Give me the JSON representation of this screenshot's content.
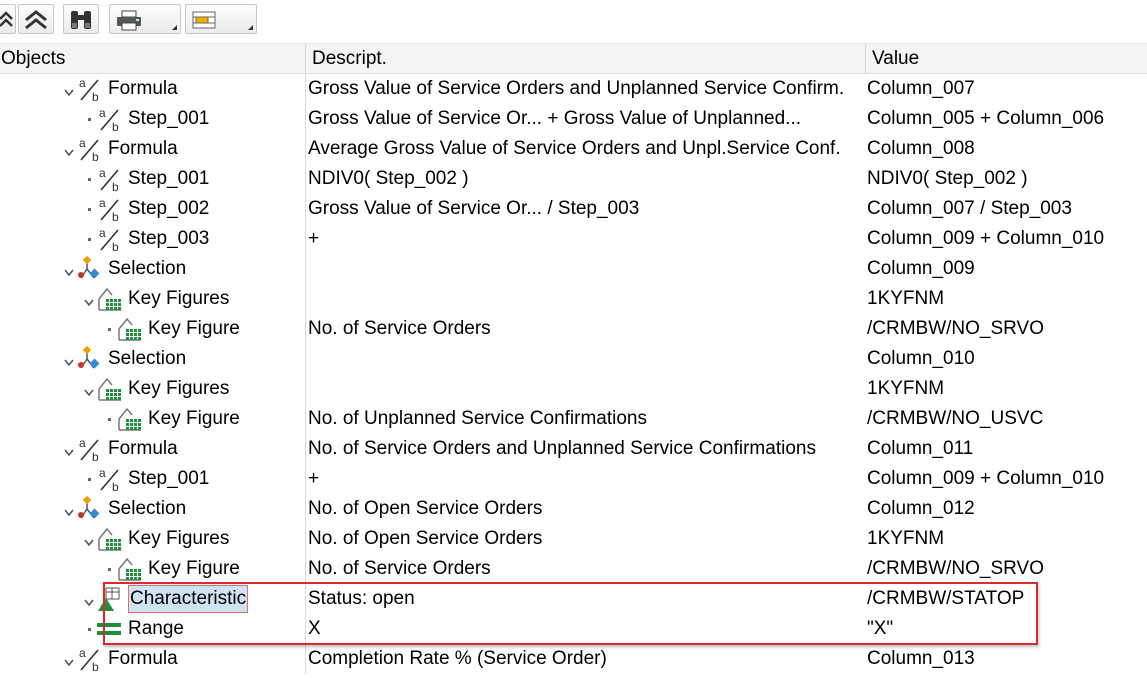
{
  "columns": {
    "objects": "Objects",
    "descript": "Descript.",
    "value": "Value"
  },
  "rows": [
    {
      "indent": 0,
      "expander": "chevron",
      "icon": "formula-icon",
      "label": "Formula",
      "desc": "Gross Value of Service Orders and Unplanned Service Confirm.",
      "value": "Column_007"
    },
    {
      "indent": 1,
      "expander": "dot",
      "icon": "formula-icon",
      "label": "Step_001",
      "desc": "Gross Value of Service Or... + Gross Value of Unplanned...",
      "value": "Column_005 + Column_006"
    },
    {
      "indent": 0,
      "expander": "chevron",
      "icon": "formula-icon",
      "label": "Formula",
      "desc": "Average Gross Value of Service Orders and Unpl.Service Conf.",
      "value": "Column_008"
    },
    {
      "indent": 1,
      "expander": "dot",
      "icon": "formula-icon",
      "label": "Step_001",
      "desc": "NDIV0( Step_002 )",
      "value": "NDIV0( Step_002 )"
    },
    {
      "indent": 1,
      "expander": "dot",
      "icon": "formula-icon",
      "label": "Step_002",
      "desc": "Gross Value of Service Or... / Step_003",
      "value": "Column_007 / Step_003"
    },
    {
      "indent": 1,
      "expander": "dot",
      "icon": "formula-icon",
      "label": "Step_003",
      "desc": "+",
      "value": "Column_009 + Column_010"
    },
    {
      "indent": 0,
      "expander": "chevron",
      "icon": "selection-icon",
      "label": "Selection",
      "desc": "",
      "value": "Column_009"
    },
    {
      "indent": 1,
      "expander": "chevron",
      "icon": "key-figures-icon",
      "label": "Key Figures",
      "desc": "",
      "value": "1KYFNM"
    },
    {
      "indent": 2,
      "expander": "dot",
      "icon": "key-figures-icon",
      "label": "Key Figure",
      "desc": "No. of Service Orders",
      "value": "/CRMBW/NO_SRVO"
    },
    {
      "indent": 0,
      "expander": "chevron",
      "icon": "selection-icon",
      "label": "Selection",
      "desc": "",
      "value": "Column_010"
    },
    {
      "indent": 1,
      "expander": "chevron",
      "icon": "key-figures-icon",
      "label": "Key Figures",
      "desc": "",
      "value": "1KYFNM"
    },
    {
      "indent": 2,
      "expander": "dot",
      "icon": "key-figures-icon",
      "label": "Key Figure",
      "desc": "No. of Unplanned Service Confirmations",
      "value": "/CRMBW/NO_USVC"
    },
    {
      "indent": 0,
      "expander": "chevron",
      "icon": "formula-icon",
      "label": "Formula",
      "desc": "No. of Service Orders and Unplanned Service Confirmations",
      "value": "Column_011"
    },
    {
      "indent": 1,
      "expander": "dot",
      "icon": "formula-icon",
      "label": "Step_001",
      "desc": "+",
      "value": "Column_009 + Column_010"
    },
    {
      "indent": 0,
      "expander": "chevron",
      "icon": "selection-icon",
      "label": "Selection",
      "desc": "No. of Open Service Orders",
      "value": "Column_012"
    },
    {
      "indent": 1,
      "expander": "chevron",
      "icon": "key-figures-icon",
      "label": "Key Figures",
      "desc": "No. of Open Service Orders",
      "value": "1KYFNM"
    },
    {
      "indent": 2,
      "expander": "dot",
      "icon": "key-figures-icon",
      "label": "Key Figure",
      "desc": "No. of Service Orders",
      "value": "/CRMBW/NO_SRVO"
    },
    {
      "indent": 1,
      "expander": "chevron",
      "icon": "characteristic-icon",
      "label": "Characteristic",
      "desc": "Status: open",
      "value": "/CRMBW/STATOP",
      "selected": true
    },
    {
      "indent": 1,
      "expander": "dot",
      "icon": "range-icon",
      "label": "Range",
      "desc": "X",
      "value": "\"X\""
    },
    {
      "indent": 0,
      "expander": "chevron",
      "icon": "formula-icon",
      "label": "Formula",
      "desc": "Completion Rate % (Service Order)",
      "value": "Column_013"
    }
  ]
}
